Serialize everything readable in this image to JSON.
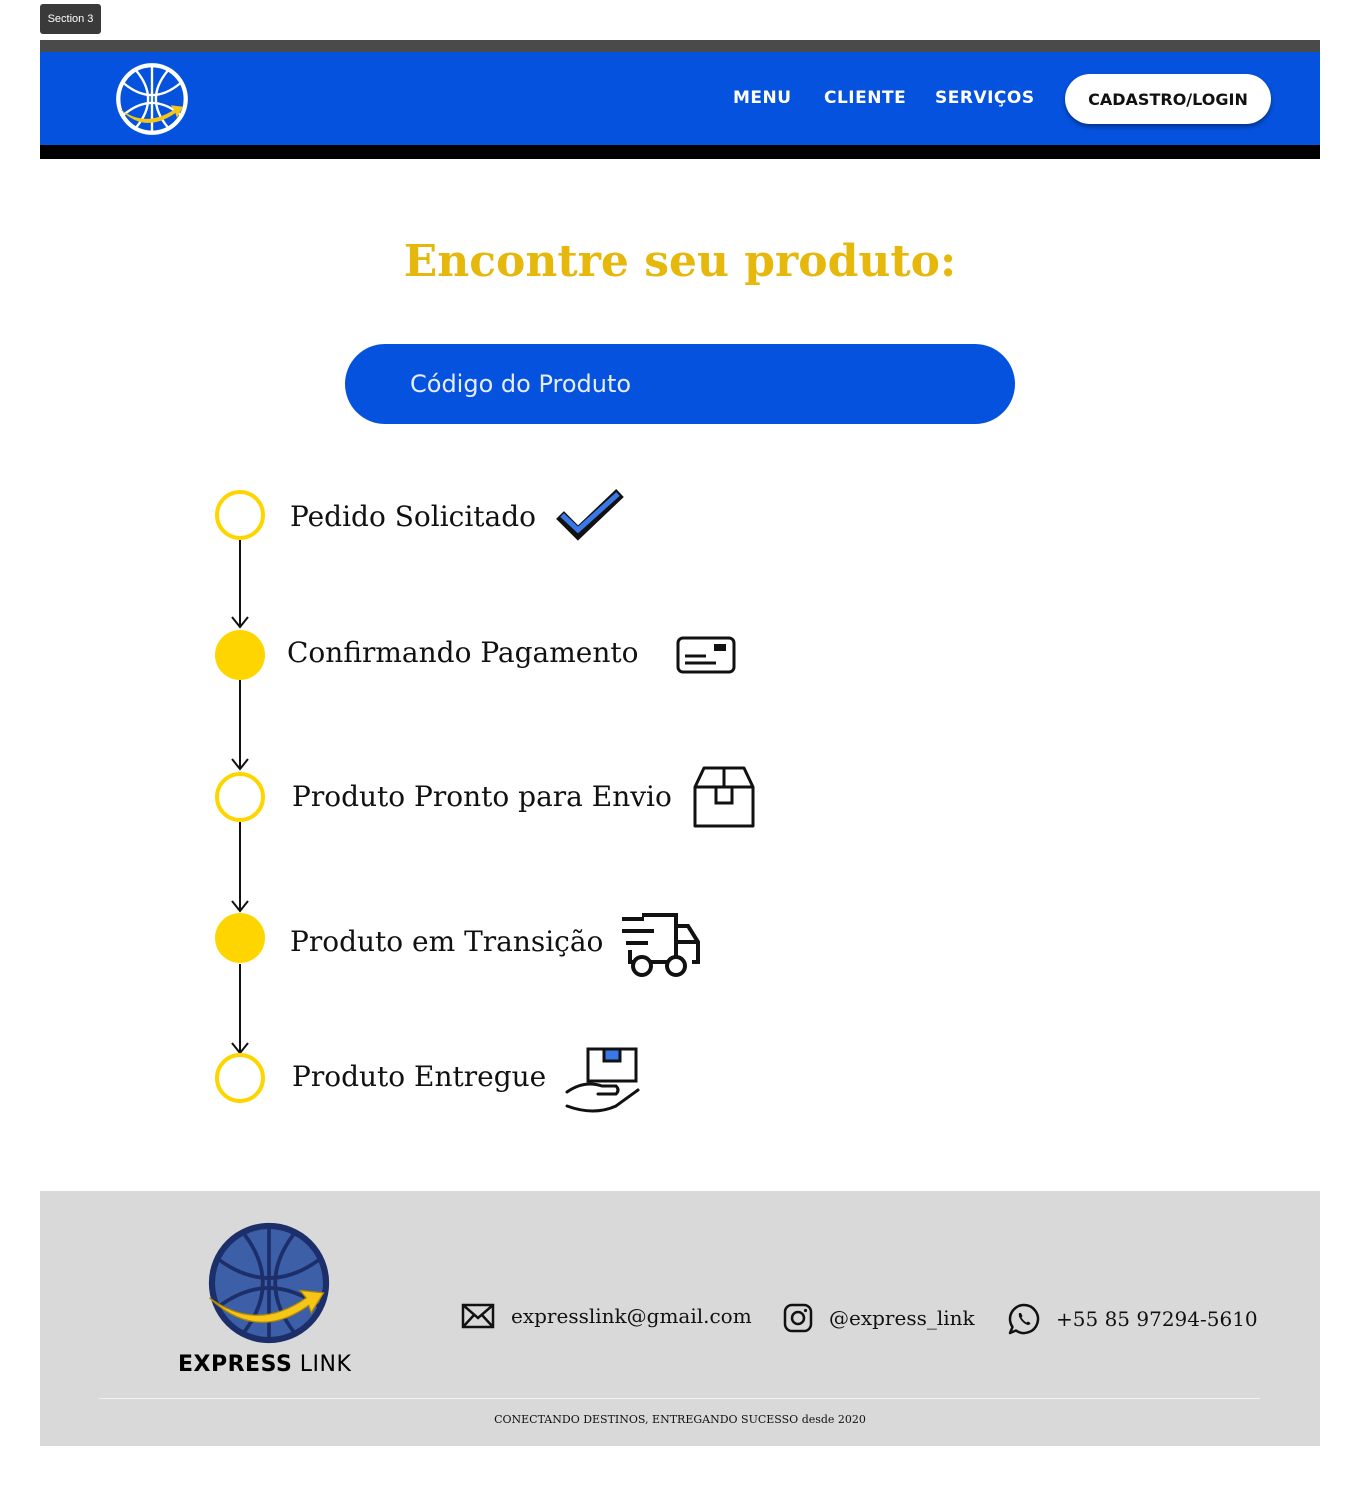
{
  "section_label": "Section 3",
  "nav": {
    "links": [
      "MENU",
      "CLIENTE",
      "SERVIÇOS"
    ],
    "cta": "CADASTRO/LOGIN",
    "logo_icon": "globe-arrow-logo"
  },
  "main": {
    "title": "Encontre seu produto:",
    "search_placeholder": "Código do Produto"
  },
  "timeline": [
    {
      "label": "Pedido Solicitado",
      "filled": false,
      "icon": "checkmark-icon"
    },
    {
      "label": "Confirmando Pagamento",
      "filled": true,
      "icon": "credit-card-icon"
    },
    {
      "label": "Produto Pronto para Envio",
      "filled": false,
      "icon": "package-box-icon"
    },
    {
      "label": "Produto em Transição",
      "filled": true,
      "icon": "delivery-truck-icon"
    },
    {
      "label": "Produto Entregue",
      "filled": false,
      "icon": "hand-package-icon"
    }
  ],
  "footer": {
    "brand_bold": "EXPRESS",
    "brand_light": "LINK",
    "email": "expresslink@gmail.com",
    "instagram": "@express_link",
    "phone": "+55 85 97294-5610",
    "tagline": "CONECTANDO DESTINOS, ENTREGANDO SUCESSO desde 2020"
  },
  "colors": {
    "primary_blue": "#0452dd",
    "accent_yellow": "#ffd500",
    "title_gold": "#e5b80b",
    "footer_gray": "#d9d9d9"
  }
}
